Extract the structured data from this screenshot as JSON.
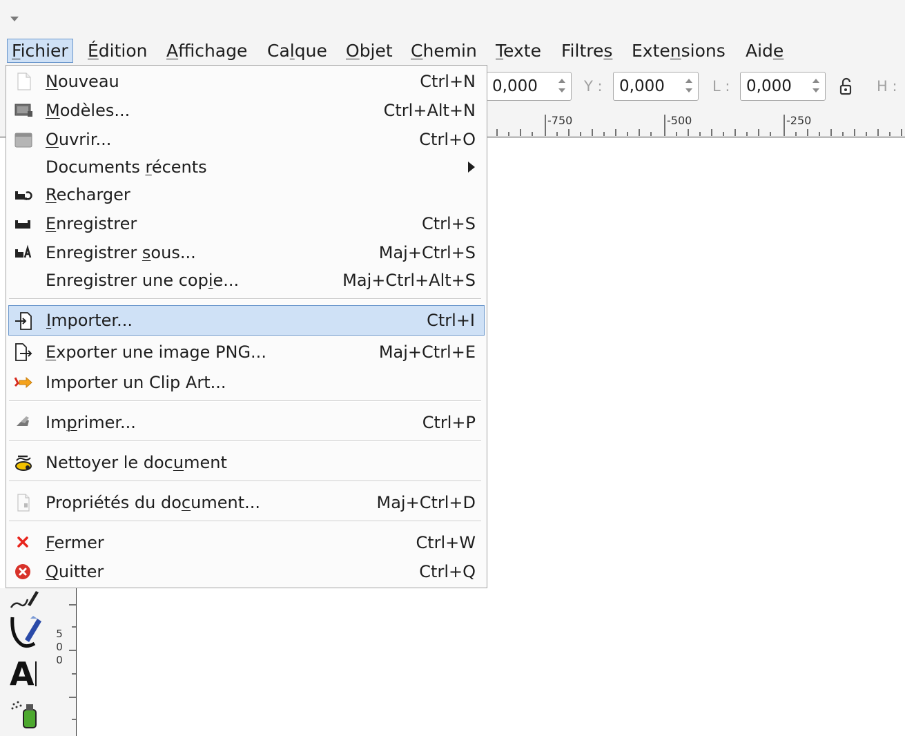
{
  "menubar": {
    "items": [
      {
        "pre": "",
        "u": "F",
        "post": "ichier"
      },
      {
        "pre": "",
        "u": "É",
        "post": "dition"
      },
      {
        "pre": "",
        "u": "A",
        "post": "ffichage"
      },
      {
        "pre": "Ca",
        "u": "l",
        "post": "que"
      },
      {
        "pre": "",
        "u": "O",
        "post": "bjet"
      },
      {
        "pre": "",
        "u": "C",
        "post": "hemin"
      },
      {
        "pre": "",
        "u": "T",
        "post": "exte"
      },
      {
        "pre": "Filtre",
        "u": "s",
        "post": ""
      },
      {
        "pre": "Exte",
        "u": "n",
        "post": "sions"
      },
      {
        "pre": "Aid",
        "u": "e",
        "post": ""
      }
    ]
  },
  "toolbar": {
    "x_value": "0,000",
    "y_label": "Y :",
    "y_value": "0,000",
    "w_label": "L :",
    "w_value": "0,000",
    "h_label": "H :"
  },
  "ruler": {
    "h_labels": [
      "-750",
      "-500",
      "-250"
    ],
    "v_label_digits": [
      "5",
      "0",
      "0"
    ]
  },
  "file_menu": {
    "items": [
      {
        "pre": "",
        "u": "N",
        "post": "ouveau",
        "shortcut": "Ctrl+N",
        "icon": "new-document-icon"
      },
      {
        "pre": "",
        "u": "M",
        "post": "odèles...",
        "shortcut": "Ctrl+Alt+N",
        "icon": "templates-icon"
      },
      {
        "pre": "",
        "u": "O",
        "post": "uvrir...",
        "shortcut": "Ctrl+O",
        "icon": "open-folder-icon"
      },
      {
        "pre": "Documents ",
        "u": "r",
        "post": "écents",
        "shortcut": "",
        "icon": ""
      },
      {
        "pre": "",
        "u": "R",
        "post": "echarger",
        "shortcut": "",
        "icon": "revert-icon"
      },
      {
        "pre": "",
        "u": "E",
        "post": "nregistrer",
        "shortcut": "Ctrl+S",
        "icon": "save-icon"
      },
      {
        "pre": "Enregistrer ",
        "u": "s",
        "post": "ous...",
        "shortcut": "Maj+Ctrl+S",
        "icon": "save-as-icon"
      },
      {
        "pre": "Enregistrer une cop",
        "u": "i",
        "post": "e...",
        "shortcut": "Maj+Ctrl+Alt+S",
        "icon": ""
      },
      {
        "pre": "",
        "u": "I",
        "post": "mporter...",
        "shortcut": "Ctrl+I",
        "icon": "import-icon"
      },
      {
        "pre": "",
        "u": "E",
        "post": "xporter une image PNG...",
        "shortcut": "Maj+Ctrl+E",
        "icon": "export-icon"
      },
      {
        "pre": "Importer un Clip Art...",
        "u": "",
        "post": "",
        "shortcut": "",
        "icon": "clipart-icon"
      },
      {
        "pre": "Im",
        "u": "p",
        "post": "rimer...",
        "shortcut": "Ctrl+P",
        "icon": "print-icon"
      },
      {
        "pre": "Nettoyer le doc",
        "u": "u",
        "post": "ment",
        "shortcut": "",
        "icon": "vacuum-icon"
      },
      {
        "pre": "Propriétés du do",
        "u": "c",
        "post": "ument...",
        "shortcut": "Maj+Ctrl+D",
        "icon": "document-properties-icon"
      },
      {
        "pre": "",
        "u": "F",
        "post": "ermer",
        "shortcut": "Ctrl+W",
        "icon": "close-icon"
      },
      {
        "pre": "",
        "u": "Q",
        "post": "uitter",
        "shortcut": "Ctrl+Q",
        "icon": "quit-icon"
      }
    ]
  },
  "colors": {
    "highlight": "#cfe1f6",
    "highlight_border": "#6b97cc",
    "close_red": "#e8241c",
    "quit_red": "#d8322a"
  }
}
